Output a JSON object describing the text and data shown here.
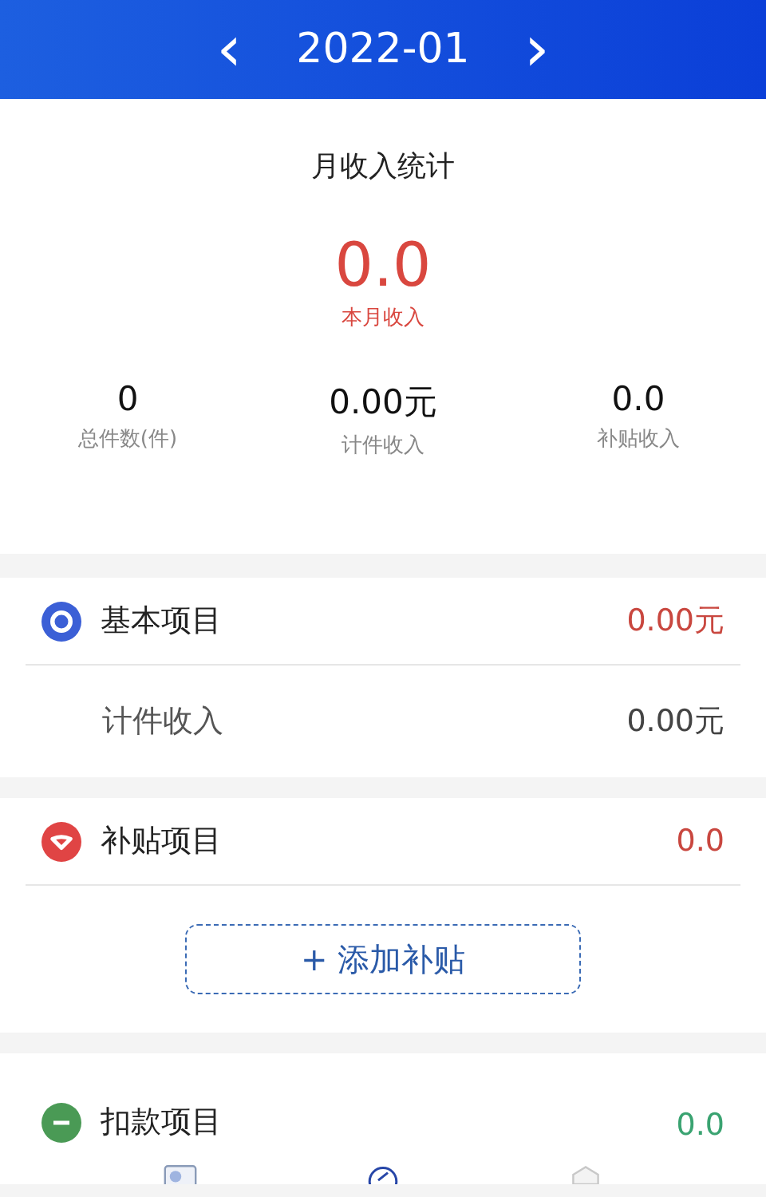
{
  "header": {
    "prev": "‹",
    "month": "2022-01",
    "next": "›"
  },
  "summary": {
    "title": "月收入统计",
    "total": "0.0",
    "total_label": "本月收入",
    "stats": [
      {
        "value": "0",
        "label": "总件数(件)"
      },
      {
        "value": "0.00元",
        "label": "计件收入"
      },
      {
        "value": "0.0",
        "label": "补贴收入"
      }
    ]
  },
  "sections": [
    {
      "kind": "basic",
      "title": "基本项目",
      "value": "0.00元",
      "color": "#3b5fd6",
      "rows": [
        {
          "label": "计件收入",
          "value": "0.00元"
        }
      ]
    },
    {
      "kind": "subsidy",
      "title": "补贴项目",
      "value": "0.0",
      "color": "#e04444",
      "button": "+ 添加补贴"
    },
    {
      "kind": "deduction",
      "title": "扣款项目",
      "value": "0.0",
      "color": "#4a9a55"
    }
  ]
}
